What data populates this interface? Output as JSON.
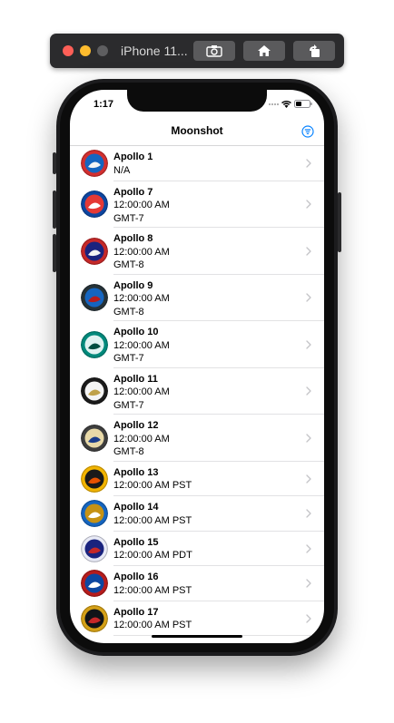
{
  "window": {
    "device_name": "iPhone 11...",
    "buttons": [
      {
        "icon": "screenshot-icon"
      },
      {
        "icon": "home-icon"
      },
      {
        "icon": "rotate-icon"
      }
    ]
  },
  "status_bar": {
    "time": "1:17"
  },
  "navbar": {
    "title": "Moonshot",
    "right_icon": "filter-icon"
  },
  "missions": [
    {
      "name": "Apollo 1",
      "lines": [
        "N/A"
      ]
    },
    {
      "name": "Apollo 7",
      "lines": [
        "12:00:00 AM",
        "GMT-7"
      ]
    },
    {
      "name": "Apollo 8",
      "lines": [
        "12:00:00 AM",
        "GMT-8"
      ]
    },
    {
      "name": "Apollo 9",
      "lines": [
        "12:00:00 AM",
        "GMT-8"
      ]
    },
    {
      "name": "Apollo 10",
      "lines": [
        "12:00:00 AM",
        "GMT-7"
      ]
    },
    {
      "name": "Apollo 11",
      "lines": [
        "12:00:00 AM",
        "GMT-7"
      ]
    },
    {
      "name": "Apollo 12",
      "lines": [
        "12:00:00 AM",
        "GMT-8"
      ]
    },
    {
      "name": "Apollo 13",
      "lines": [
        "12:00:00 AM PST"
      ]
    },
    {
      "name": "Apollo 14",
      "lines": [
        "12:00:00 AM PST"
      ]
    },
    {
      "name": "Apollo 15",
      "lines": [
        "12:00:00 AM PDT"
      ]
    },
    {
      "name": "Apollo 16",
      "lines": [
        "12:00:00 AM PST"
      ]
    },
    {
      "name": "Apollo 17",
      "lines": [
        "12:00:00 AM PST"
      ]
    }
  ],
  "colors": {
    "accent": "#0a84ff",
    "separator": "#e2e2e4",
    "chevron": "#c4c4c7"
  }
}
